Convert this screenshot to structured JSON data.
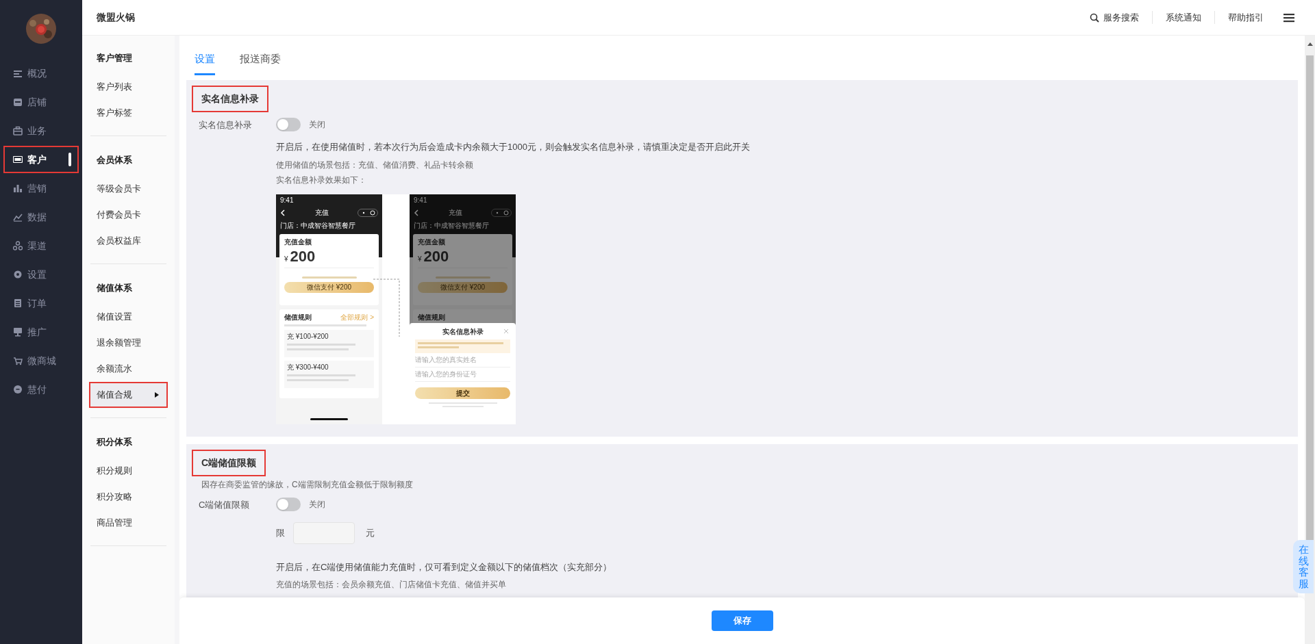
{
  "app": {
    "title": "微盟火锅"
  },
  "nav": [
    {
      "label": "概况",
      "selected": false,
      "highlighted": false
    },
    {
      "label": "店铺",
      "selected": false,
      "highlighted": false
    },
    {
      "label": "业务",
      "selected": false,
      "highlighted": false
    },
    {
      "label": "客户",
      "selected": true,
      "highlighted": true
    },
    {
      "label": "营销",
      "selected": false,
      "highlighted": false
    },
    {
      "label": "数据",
      "selected": false,
      "highlighted": false
    },
    {
      "label": "渠道",
      "selected": false,
      "highlighted": false
    },
    {
      "label": "设置",
      "selected": false,
      "highlighted": false
    },
    {
      "label": "订单",
      "selected": false,
      "highlighted": false
    },
    {
      "label": "推广",
      "selected": false,
      "highlighted": false
    },
    {
      "label": "微商城",
      "selected": false,
      "highlighted": false
    },
    {
      "label": "慧付",
      "selected": false,
      "highlighted": false
    }
  ],
  "submenu": [
    {
      "heading": "客户管理",
      "items": [
        {
          "label": "客户列表",
          "selected": false,
          "highlighted": false
        },
        {
          "label": "客户标签",
          "selected": false,
          "highlighted": false
        }
      ]
    },
    {
      "heading": "会员体系",
      "items": [
        {
          "label": "等级会员卡",
          "selected": false,
          "highlighted": false
        },
        {
          "label": "付费会员卡",
          "selected": false,
          "highlighted": false
        },
        {
          "label": "会员权益库",
          "selected": false,
          "highlighted": false
        }
      ]
    },
    {
      "heading": "储值体系",
      "items": [
        {
          "label": "储值设置",
          "selected": false,
          "highlighted": false
        },
        {
          "label": "退余额管理",
          "selected": false,
          "highlighted": false
        },
        {
          "label": "余额流水",
          "selected": false,
          "highlighted": false
        },
        {
          "label": "储值合规",
          "selected": true,
          "highlighted": true
        }
      ]
    },
    {
      "heading": "积分体系",
      "items": [
        {
          "label": "积分规则",
          "selected": false,
          "highlighted": false
        },
        {
          "label": "积分攻略",
          "selected": false,
          "highlighted": false
        },
        {
          "label": "商品管理",
          "selected": false,
          "highlighted": false
        }
      ]
    }
  ],
  "top_actions": [
    {
      "label": "服务搜索",
      "kind": "search"
    },
    {
      "label": "系统通知",
      "kind": "text"
    },
    {
      "label": "帮助指引",
      "kind": "text"
    }
  ],
  "tabs": [
    {
      "label": "设置",
      "selected": true
    },
    {
      "label": "报送商委",
      "selected": false
    }
  ],
  "sections": [
    {
      "title": "实名信息补录",
      "highlighted": true,
      "switch": {
        "label": "实名信息补录",
        "on": false,
        "state_text": "关闭"
      },
      "notes": [
        "开启后，在使用储值时，若本次行为后会造成卡内余额大于1000元，则会触发实名信息补录，请慎重决定是否开启此开关",
        "使用储值的场景包括：充值、储值消费、礼品卡转余额",
        "实名信息补录效果如下："
      ],
      "preview": {
        "left": {
          "time": "9:41",
          "title": "充值",
          "store": "门店：中成智谷智慧餐厅",
          "amount_label": "充值金额",
          "currency": "¥",
          "amount": "200",
          "pay_button": "微信支付 ¥200",
          "rules_title": "储值规则",
          "rules_link": "全部规则 >",
          "tiers": [
            "充 ¥100-¥200",
            "充 ¥300-¥400"
          ]
        },
        "right": {
          "time": "9:41",
          "title": "充值",
          "store": "门店：中成智谷智慧餐厅",
          "amount_label": "充值金额",
          "currency": "¥",
          "amount": "200",
          "pay_button": "微信支付 ¥200",
          "rules_title": "储值规则"
        },
        "dialog": {
          "title": "实名信息补录",
          "fields": [
            "请输入您的真实姓名",
            "请输入您的身份证号"
          ],
          "submit": "提交"
        }
      }
    },
    {
      "title": "C端储值限额",
      "highlighted": true,
      "description": "因存在商委监管的缘故，C端需限制充值金额低于限制额度",
      "switch": {
        "label": "C端储值限额",
        "on": false,
        "state_text": "关闭"
      },
      "limit": {
        "prefix": "限",
        "suffix": "元"
      },
      "notes": [
        "开启后，在C端使用储值能力充值时，仅可看到定义金额以下的储值档次（实充部分）",
        "充值的场景包括：会员余额充值、门店储值卡充值、储值并买单"
      ]
    }
  ],
  "save_button": "保存",
  "support_tab": "在线客服"
}
